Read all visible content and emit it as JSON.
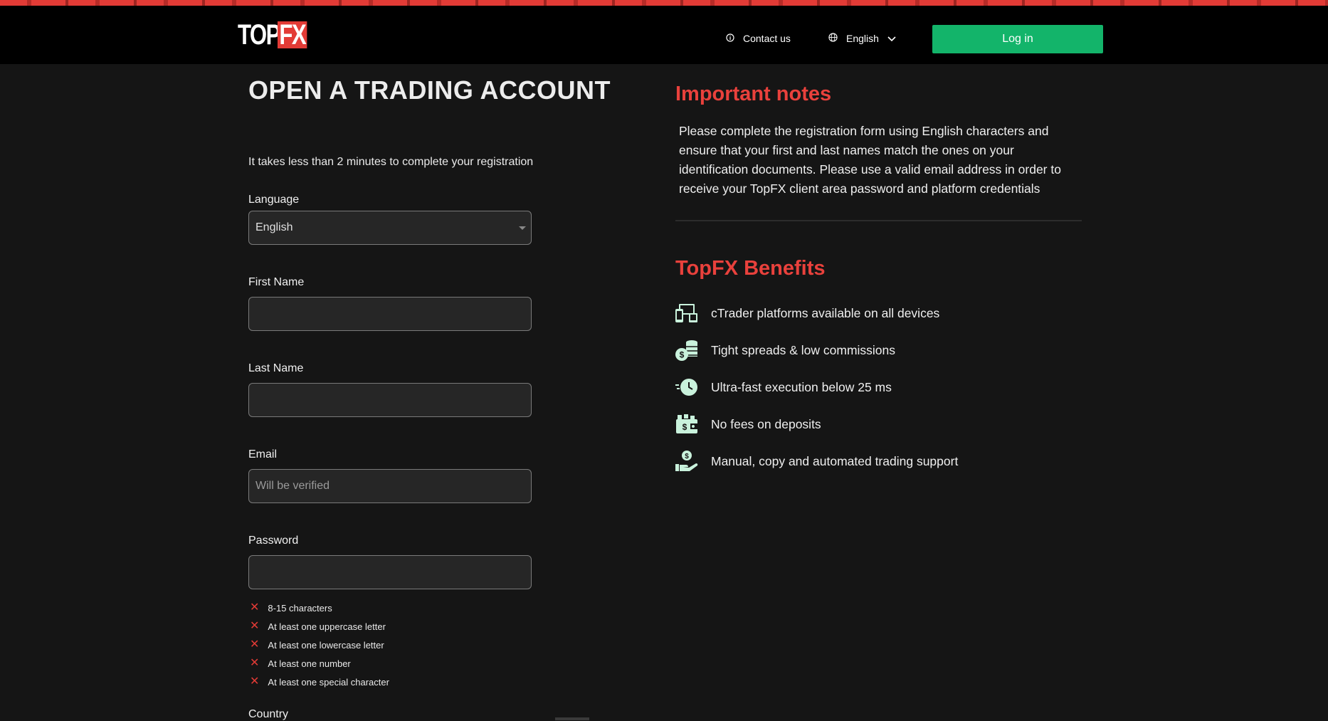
{
  "header": {
    "logo_top": "TOP",
    "logo_fx": "FX",
    "contact_label": "Contact us",
    "language_label": "English",
    "login_label": "Log in"
  },
  "form": {
    "title": "OPEN A TRADING ACCOUNT",
    "subtitle": "It takes less than 2 minutes to complete your registration",
    "language": {
      "label": "Language",
      "value": "English"
    },
    "first_name": {
      "label": "First Name",
      "value": "",
      "placeholder": ""
    },
    "last_name": {
      "label": "Last Name",
      "value": "",
      "placeholder": ""
    },
    "email": {
      "label": "Email",
      "value": "",
      "placeholder": "Will be verified"
    },
    "password": {
      "label": "Password",
      "value": "",
      "placeholder": ""
    },
    "password_rules": [
      "8-15 characters",
      "At least one uppercase letter",
      "At least one lowercase letter",
      "At least one number",
      "At least one special character"
    ],
    "country_label": "Country"
  },
  "notes": {
    "title": "Important notes",
    "text": "Please complete the registration form using English characters and ensure that your first and last names match the ones on your identification documents. Please use a valid email address in order to receive your TopFX client area password and platform credentials"
  },
  "benefits": {
    "title": "TopFX Benefits",
    "items": [
      {
        "icon": "devices-icon",
        "label": "cTrader platforms available on all devices"
      },
      {
        "icon": "coins-icon",
        "label": "Tight spreads & low commissions"
      },
      {
        "icon": "fast-clock-icon",
        "label": "Ultra-fast execution below 25 ms"
      },
      {
        "icon": "wallet-icon",
        "label": "No fees on deposits"
      },
      {
        "icon": "money-hand-icon",
        "label": "Manual, copy and automated trading support"
      }
    ]
  },
  "colors": {
    "accent_red": "#e9413c",
    "login_green": "#13b46a",
    "icon_mint": "#c9f2dc",
    "background": "#151515"
  }
}
